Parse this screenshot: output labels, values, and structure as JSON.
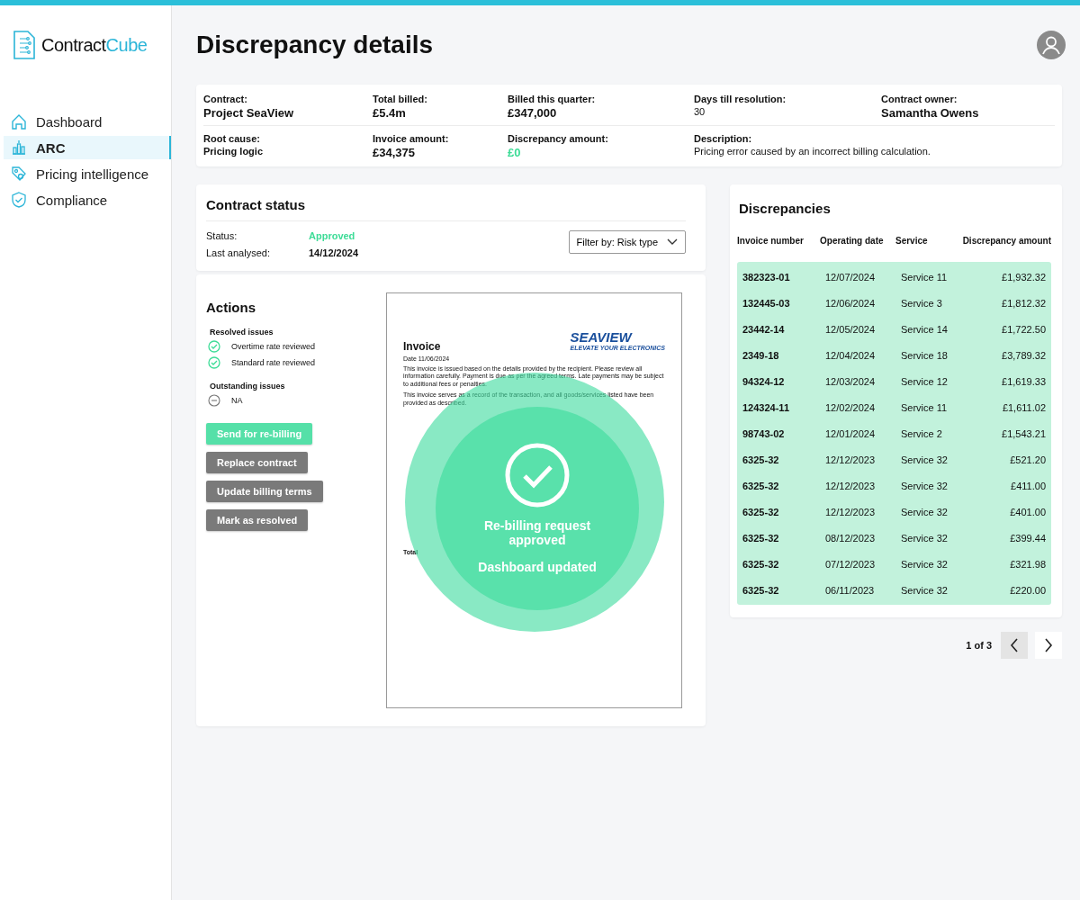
{
  "logo": {
    "part_1": "Contract",
    "part_2": "Cube"
  },
  "sidebar": {
    "items": [
      {
        "label": "Dashboard",
        "selected": false
      },
      {
        "label": "ARC",
        "selected": true
      },
      {
        "label": "Pricing intelligence",
        "selected": false
      },
      {
        "label": "Compliance",
        "selected": false
      }
    ]
  },
  "header": {
    "title": "Discrepancy details"
  },
  "summary": {
    "rows": [
      [
        {
          "label": "Contract:",
          "value": "Project SeaView",
          "kind": "large"
        },
        {
          "label": "Total billed:",
          "value": "£5.4m",
          "kind": "large"
        },
        {
          "label": "Billed this quarter:",
          "value": "£347,000",
          "kind": "large"
        },
        {
          "label": "Days till resolution:",
          "value": "30",
          "kind": "small"
        },
        {
          "label": "Contract owner:",
          "value": "Samantha Owens",
          "kind": "large"
        }
      ],
      [
        {
          "label": "Root cause:",
          "value": "Pricing logic",
          "kind": "small"
        },
        {
          "label": "Invoice amount:",
          "value": "£34,375",
          "kind": "large"
        },
        {
          "label": "Discrepancy amount:",
          "value": "£0",
          "kind": "positive"
        },
        {
          "label": "Description:",
          "value": "Pricing error caused by an incorrect billing calculation.",
          "kind": "text"
        }
      ]
    ]
  },
  "contract_status": {
    "title": "Contract status",
    "fields": [
      {
        "label": "Status:",
        "value": "Approved",
        "kind": "positive"
      },
      {
        "label": "Last analysed:",
        "value": "14/12/2024",
        "kind": "plain"
      }
    ],
    "filter": {
      "label": "Filter by: Risk type"
    }
  },
  "actions": {
    "title": "Actions",
    "groups": [
      {
        "title": "Resolved issues",
        "items": [
          {
            "label": "Overtime rate reviewed",
            "kind": "done"
          },
          {
            "label": "Standard rate reviewed",
            "kind": "done"
          }
        ]
      },
      {
        "title": "Outstanding issues",
        "items": [
          {
            "label": "NA",
            "kind": "none"
          }
        ]
      }
    ],
    "buttons": [
      {
        "label": "Send for re-billing",
        "kind": "primary"
      },
      {
        "label": "Replace contract",
        "kind": "secondary"
      },
      {
        "label": "Update billing terms",
        "kind": "secondary"
      },
      {
        "label": "Mark as resolved",
        "kind": "secondary"
      }
    ]
  },
  "document": {
    "title": "Invoice",
    "brand": "SEAVIEW",
    "tagline": "ELEVATE YOUR ELECTRONICS",
    "date": "Date 11/06/2024",
    "paragraphs": [
      "This invoice is issued based on the details provided by the recipient. Please review all information carefully. Payment is due as per the agreed terms. Late payments may be subject to additional fees or penalties.",
      "This invoice serves as a record of the transaction, and all goods/services listed have been provided as described."
    ],
    "total": "Total"
  },
  "overlay": {
    "lines": [
      "Re-billing request approved",
      "Dashboard updated"
    ]
  },
  "discrepancies": {
    "title": "Discrepancies",
    "columns": [
      "Invoice number",
      "Operating date",
      "Service",
      "Discrepancy amount"
    ],
    "rows": [
      [
        "382323-01",
        "12/07/2024",
        "Service 11",
        "£1,932.32"
      ],
      [
        "132445-03",
        "12/06/2024",
        "Service 3",
        "£1,812.32"
      ],
      [
        "23442-14",
        "12/05/2024",
        "Service 14",
        "£1,722.50"
      ],
      [
        "2349-18",
        "12/04/2024",
        "Service 18",
        "£3,789.32"
      ],
      [
        "94324-12",
        "12/03/2024",
        "Service 12",
        "£1,619.33"
      ],
      [
        "124324-11",
        "12/02/2024",
        "Service 11",
        "£1,611.02"
      ],
      [
        "98743-02",
        "12/01/2024",
        "Service 2",
        "£1,543.21"
      ],
      [
        "6325-32",
        "12/12/2023",
        "Service 32",
        "£521.20"
      ],
      [
        "6325-32",
        "12/12/2023",
        "Service 32",
        "£411.00"
      ],
      [
        "6325-32",
        "12/12/2023",
        "Service 32",
        "£401.00"
      ],
      [
        "6325-32",
        "08/12/2023",
        "Service 32",
        "£399.44"
      ],
      [
        "6325-32",
        "07/12/2023",
        "Service 32",
        "£321.98"
      ],
      [
        "6325-32",
        "06/11/2023",
        "Service 32",
        "£220.00"
      ]
    ],
    "pagination": {
      "label": "1 of 3"
    }
  }
}
